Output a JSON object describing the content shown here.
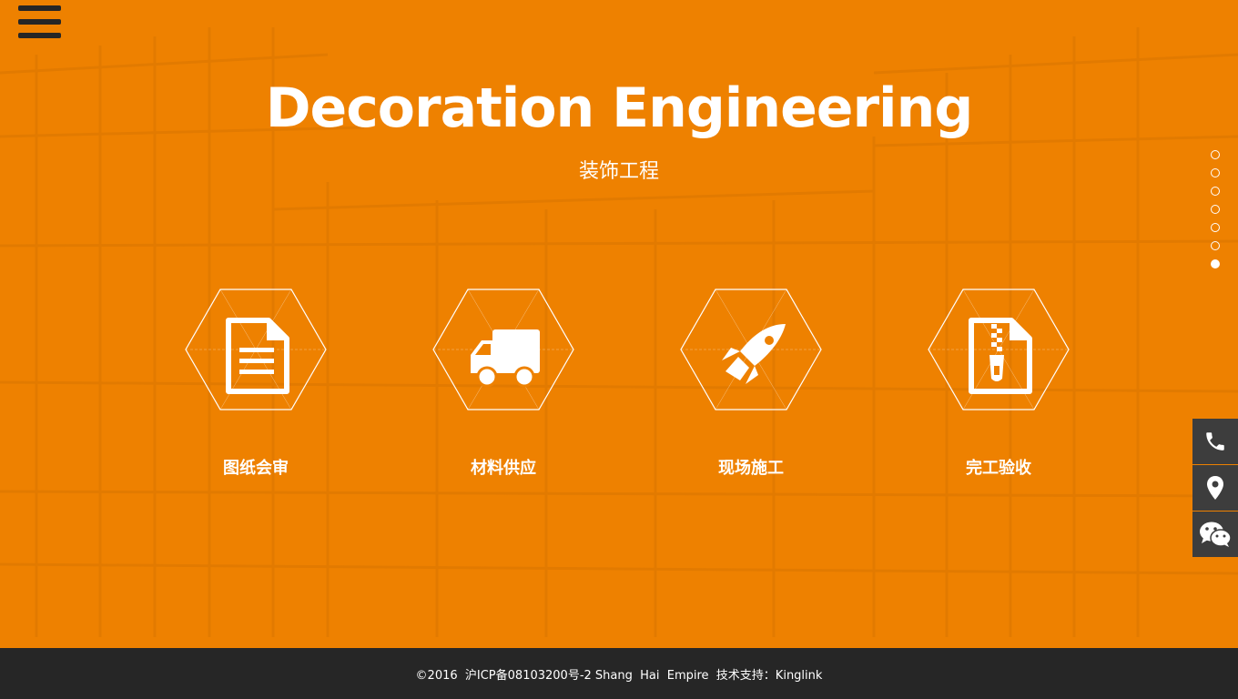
{
  "hero": {
    "title": "Decoration Engineering",
    "subtitle": "装饰工程"
  },
  "menu": {
    "icon": "hamburger-menu-icon"
  },
  "pager": {
    "count": 7,
    "active_index": 6
  },
  "services": [
    {
      "label": "图纸会审",
      "icon": "document-icon"
    },
    {
      "label": "材料供应",
      "icon": "truck-icon"
    },
    {
      "label": "现场施工",
      "icon": "rocket-icon"
    },
    {
      "label": "完工验收",
      "icon": "zip-file-icon"
    }
  ],
  "contact_sidebar": [
    {
      "icon": "phone-icon"
    },
    {
      "icon": "location-pin-icon"
    },
    {
      "icon": "wechat-icon"
    }
  ],
  "footer": {
    "text": "©2016  沪ICP备08103200号-2 Shang  Hai  Empire  技术支持：Kinglink"
  },
  "colors": {
    "background": "#ee8100",
    "footer": "#262626",
    "sidebar": "#3d3d3d",
    "foreground": "#ffffff"
  }
}
